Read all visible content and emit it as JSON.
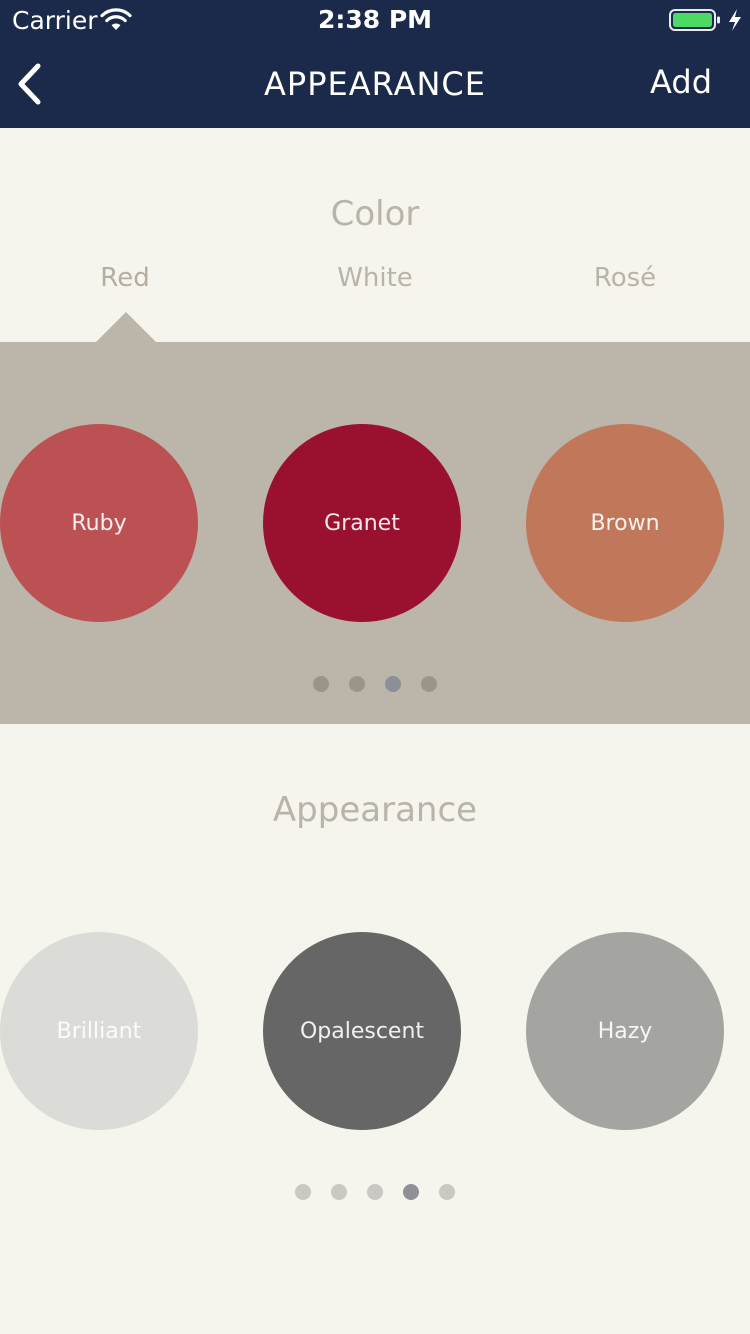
{
  "status_bar": {
    "carrier": "Carrier",
    "time": "2:38 PM"
  },
  "nav": {
    "title": "APPEARANCE",
    "add_label": "Add",
    "back_icon": "chevron-left-icon"
  },
  "color_section": {
    "heading": "Color",
    "tabs": [
      {
        "label": "Red",
        "selected": true
      },
      {
        "label": "White",
        "selected": false
      },
      {
        "label": "Rosé",
        "selected": false
      }
    ],
    "swatches": [
      {
        "label": "Ruby",
        "color": "#bb5153"
      },
      {
        "label": "Granet",
        "color": "#9a1130"
      },
      {
        "label": "Brown",
        "color": "#c1775a"
      }
    ],
    "page_count": 4,
    "current_page": 3
  },
  "appearance_section": {
    "heading": "Appearance",
    "swatches": [
      {
        "label": "Brilliant",
        "color": "#dbdbd7"
      },
      {
        "label": "Opalescent",
        "color": "#666666"
      },
      {
        "label": "Hazy",
        "color": "#a4a4a0"
      }
    ],
    "page_count": 5,
    "current_page": 4
  },
  "colors": {
    "nav_background": "#1b294b",
    "page_background": "#f6f5ed",
    "panel_background": "#bcb5aa",
    "heading_text": "#bab3a7"
  }
}
